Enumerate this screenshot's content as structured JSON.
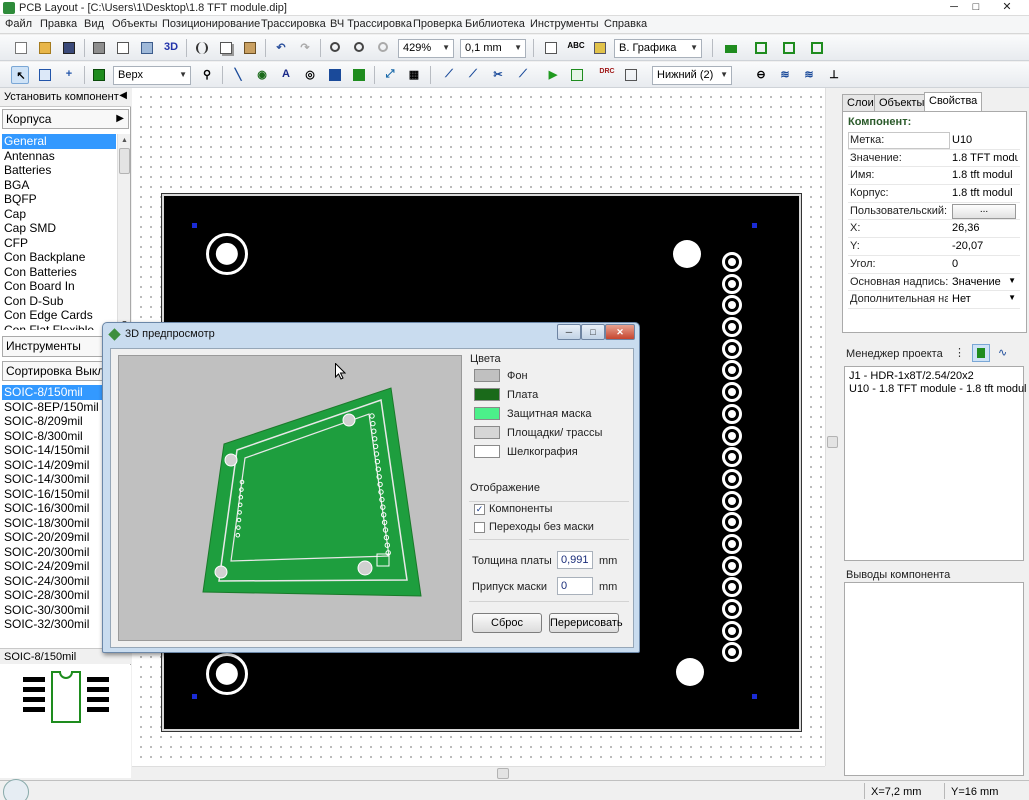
{
  "window": {
    "title": "PCB Layout - [C:\\Users\\1\\Desktop\\1.8 TFT module.dip]",
    "minimize": "─",
    "maximize": "□",
    "close": "✕"
  },
  "menu": [
    "Файл",
    "Правка",
    "Вид",
    "Объекты",
    "Позиционирование",
    "Трассировка",
    "ВЧ Трассировка",
    "Проверка",
    "Библиотека",
    "Инструменты",
    "Справка"
  ],
  "toolbar1": {
    "zoom_value": "429%",
    "grid_value": "0,1 mm",
    "graphics_mode": "В. Графика",
    "btn_3d_label": "3D"
  },
  "toolbar2": {
    "layer_top": "Верх",
    "layer_bottom": "Нижний (2)"
  },
  "left_panel": {
    "place_component": "Установить компонент",
    "packages_button": "Корпуса",
    "packages": [
      "General",
      "Antennas",
      "Batteries",
      "BGA",
      "BQFP",
      "Cap",
      "Cap SMD",
      "CFP",
      "Con Backplane",
      "Con Batteries",
      "Con Board In",
      "Con D-Sub",
      "Con Edge Cards",
      "Con Flat Flexible"
    ],
    "tools_header": "Инструменты",
    "sort_header": "Сортировка Выкл",
    "footprints": [
      "SOIC-8/150mil",
      "SOIC-8EP/150mil",
      "SOIC-8/209mil",
      "SOIC-8/300mil",
      "SOIC-14/150mil",
      "SOIC-14/209mil",
      "SOIC-14/300mil",
      "SOIC-16/150mil",
      "SOIC-16/300mil",
      "SOIC-18/300mil",
      "SOIC-20/209mil",
      "SOIC-20/300mil",
      "SOIC-24/209mil",
      "SOIC-24/300mil",
      "SOIC-28/300mil",
      "SOIC-30/300mil",
      "SOIC-32/300mil"
    ],
    "selected_footprint": "SOIC-8/150mil"
  },
  "right_panel": {
    "tabs": [
      "Слои",
      "Объекты",
      "Свойства"
    ],
    "props_title": "Компонент:",
    "props": [
      {
        "key": "Метка:",
        "value": "U10"
      },
      {
        "key": "Значение:",
        "value": "1.8 TFT modu"
      },
      {
        "key": "Имя:",
        "value": "1.8 tft modul"
      },
      {
        "key": "Корпус:",
        "value": "1.8 tft modul"
      },
      {
        "key": "Пользовательский:",
        "value": "..."
      },
      {
        "key": "X:",
        "value": "26,36"
      },
      {
        "key": "Y:",
        "value": "-20,07"
      },
      {
        "key": "Угол:",
        "value": "0"
      },
      {
        "key": "Основная надпись:",
        "value": "Значение"
      },
      {
        "key": "Дополнительная над",
        "value": "Нет"
      }
    ],
    "project_manager_label": "Менеджер проекта",
    "project_items": [
      "J1 - HDR-1x8T/2.54/20x2",
      "U10 - 1.8 TFT module - 1.8 tft modul"
    ],
    "outputs_label": "Выводы компонента"
  },
  "status": {
    "x": "X=7,2 mm",
    "y": "Y=16 mm"
  },
  "dialog": {
    "title": "3D предпросмотр",
    "colors_header": "Цвета",
    "colors": [
      {
        "label": "Фон",
        "color": "#c0c0c0"
      },
      {
        "label": "Плата",
        "color": "#1a6a1a"
      },
      {
        "label": "Защитная маска",
        "color": "#4cf08a"
      },
      {
        "label": "Площадки/ трассы",
        "color": "#d6d6d6"
      },
      {
        "label": "Шелкография",
        "color": "#ffffff"
      }
    ],
    "display_header": "Отображение",
    "show_components": "Компоненты",
    "show_components_checked": true,
    "vias_no_mask": "Переходы без маски",
    "vias_no_mask_checked": false,
    "board_thickness_label": "Толщина платы",
    "board_thickness": "0,991",
    "mask_margin_label": "Припуск маски",
    "mask_margin": "0",
    "unit_mm": "mm",
    "reset_button": "Сброс",
    "redraw_button": "Перерисовать"
  }
}
